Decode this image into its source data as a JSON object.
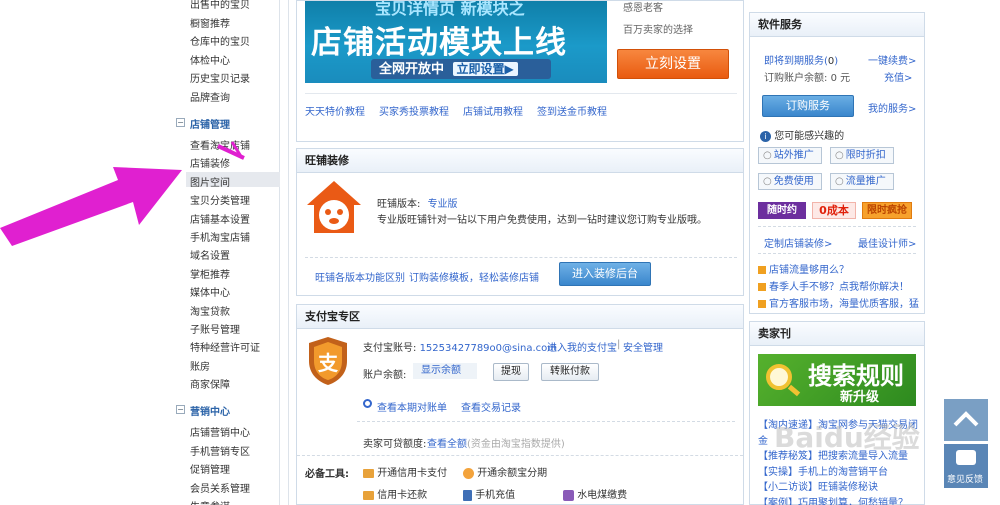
{
  "sidebar": {
    "top_items": [
      "出售中的宝贝",
      "橱窗推荐",
      "仓库中的宝贝",
      "体检中心",
      "历史宝贝记录",
      "品牌查询"
    ],
    "shop_section": "店铺管理",
    "shop_items": [
      "查看淘宝店铺",
      "店铺装修",
      "图片空间",
      "宝贝分类管理",
      "店铺基本设置",
      "手机淘宝店铺",
      "域名设置",
      "掌柜推荐",
      "媒体中心",
      "淘宝贷款",
      "子账号管理",
      "特种经营许可证",
      "账房",
      "商家保障"
    ],
    "marketing_section": "营销中心",
    "marketing_items": [
      "店铺营销中心",
      "手机营销专区",
      "促销管理",
      "会员关系管理",
      "生意参谋"
    ]
  },
  "banner": {
    "top_text": "宝贝详情页 新模块之",
    "main_text": "店铺活动模块上线",
    "strip_text": "全网开放中",
    "strip_cta": "立即设置▶",
    "side_text1": "感恩老客",
    "side_text2": "百万卖家的选择",
    "side_button": "立刻设置"
  },
  "tutorials": [
    "天天特价教程",
    "买家秀投票教程",
    "店铺试用教程",
    "签到送金币教程"
  ],
  "wangpu": {
    "title": "旺铺装修",
    "version_label": "旺铺版本:",
    "version_value": "专业版",
    "desc": "专业版旺铺针对一钻以下用户免费使用，达到一钻时建议您订购专业版哦。",
    "link1": "旺铺各版本功能区别",
    "link2": "订购装修模板，轻松装修店铺",
    "button": "进入装修后台"
  },
  "alipay": {
    "title": "支付宝专区",
    "account_label": "支付宝账号:",
    "account_value": "15253427789o0@sina.com",
    "link_my": "进入我的支付宝",
    "link_security": "安全管理",
    "balance_label": "账户余额:",
    "balance_value": "显示余额",
    "btn_withdraw": "提现",
    "btn_transfer": "转账付款",
    "bill_link": "查看本期对账单",
    "trade_link": "查看交易记录",
    "loan_label": "卖家可贷额度:",
    "loan_link": "查看全额",
    "loan_note": "(资金由淘宝指数提供)",
    "tools_label": "必备工具:",
    "tools": [
      "开通信用卡支付",
      "开通余额宝分期",
      "信用卡还款",
      "手机充值",
      "水电煤缴费"
    ]
  },
  "software": {
    "title": "软件服务",
    "expiring_label": "即将到期服务(",
    "expiring_count": "0",
    "expiring_close": ")",
    "renew": "一键续费>",
    "balance_label": "订购账户余额:",
    "balance_value": "0 元",
    "recharge": "充值>",
    "order_button": "订购服务",
    "my_service": "我的服务>",
    "interest_title": "您可能感兴趣的",
    "chips": [
      "站外推广",
      "限时折扣",
      "免费使用",
      "流量推广"
    ],
    "promo1": "随时约",
    "promo2": "0成本",
    "promo3": "限时疯抢",
    "custom_link": "定制店铺装修>",
    "design_link": "最佳设计师>",
    "news": [
      "店铺流量够用么？",
      "春季人手不够？点我帮你解决！",
      "官方客服市场，海量优质客服，猛"
    ]
  },
  "seller": {
    "title": "卖家刊",
    "banner_main": "搜索规则",
    "banner_sub": "新升级",
    "news": [
      "【淘内速递】淘宝网参与天猫交易闭",
      "金",
      "【推荐秘笈】把搜索流量导入流量",
      "【实操】手机上的淘营销平台",
      "【小二访谈】旺铺装修秘诀",
      "【案例】巧用聚划算，何愁销量？"
    ],
    "watermark": "Baidu经验"
  },
  "float": {
    "feedback": "意见反馈"
  },
  "colors": {
    "link": "#3366cc",
    "orange": "#f0641e",
    "section_title": "#2b63a8",
    "arrow": "#e020d0"
  }
}
